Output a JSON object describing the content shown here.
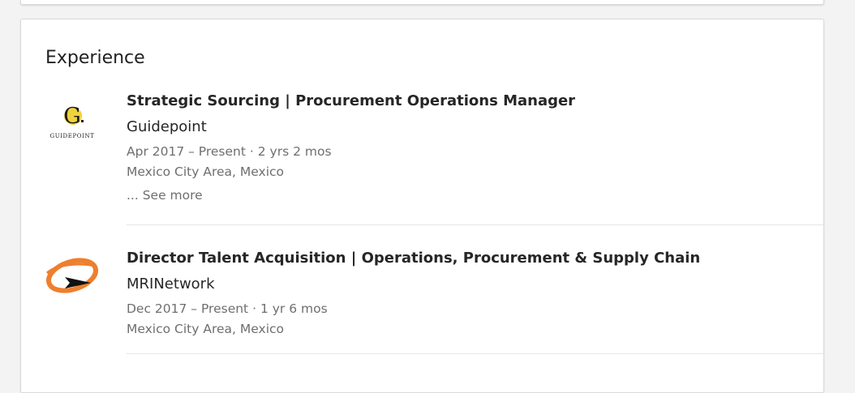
{
  "experience": {
    "title": "Experience",
    "see_more_label": "... See more",
    "entries": [
      {
        "job_title": "Strategic Sourcing | Procurement Operations Manager",
        "company": "Guidepoint",
        "logo_icon": "guidepoint-logo-icon",
        "logo_text": "GUIDEPOINT",
        "logo_colors": [
          "#1b1b1b",
          "#f0d23c"
        ],
        "date_range": "Apr 2017 – Present",
        "separator": "·",
        "duration": "2 yrs 2 mos",
        "location": "Mexico City Area, Mexico"
      },
      {
        "job_title": "Director Talent Acquisition | Operations, Procurement & Supply Chain",
        "company": "MRINetwork",
        "logo_icon": "mrinetwork-logo-icon",
        "logo_colors": [
          "#ee7f2d",
          "#111111"
        ],
        "date_range": "Dec 2017 – Present",
        "separator": "·",
        "duration": "1 yr 6 mos",
        "location": "Mexico City Area, Mexico"
      }
    ]
  },
  "colors": {
    "background": "#f3f3f3",
    "card": "#ffffff",
    "primary_text": "#262626",
    "secondary_text": "#6f6f6f",
    "divider": "#e6e6e6"
  }
}
